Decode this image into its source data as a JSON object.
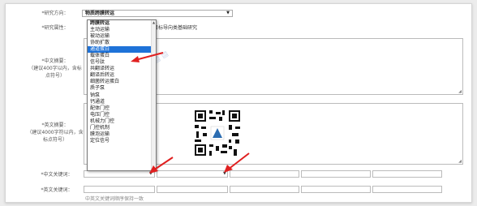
{
  "form": {
    "research_direction": {
      "label": "*研究方向：",
      "value": "物质跨膜转运"
    },
    "research_attribute": {
      "label": "*研究属性：",
      "text": "目标导向类基础研究"
    },
    "cn_abstract": {
      "label": "*中文摘要：",
      "hint": "（建议400字以内，含标点符号）"
    },
    "en_abstract": {
      "label": "*英文摘要：",
      "hint": "（建议4000字符以内，含标点符号）"
    },
    "cn_keywords": {
      "label": "*中文关键词："
    },
    "en_keywords": {
      "label": "*英文关键词：",
      "hint": "中英文关键词顺序保持一致"
    }
  },
  "dropdown": {
    "options": [
      {
        "label": "跨膜转运",
        "selected": false,
        "header": true
      },
      {
        "label": "主动运输",
        "selected": false,
        "header": false
      },
      {
        "label": "被动运输",
        "selected": false,
        "header": false
      },
      {
        "label": "协助扩散",
        "selected": false,
        "header": false
      },
      {
        "label": "通道蛋白",
        "selected": true,
        "header": false
      },
      {
        "label": "载体蛋白",
        "selected": false,
        "header": false
      },
      {
        "label": "信号肽",
        "selected": false,
        "header": false
      },
      {
        "label": "共翻译转运",
        "selected": false,
        "header": false
      },
      {
        "label": "翻译后转运",
        "selected": false,
        "header": false
      },
      {
        "label": "细菌转运蛋白",
        "selected": false,
        "header": false
      },
      {
        "label": "质子泵",
        "selected": false,
        "header": false
      },
      {
        "label": "钠泵",
        "selected": false,
        "header": false
      },
      {
        "label": "钙通道",
        "selected": false,
        "header": false
      },
      {
        "label": "配体门控",
        "selected": false,
        "header": false
      },
      {
        "label": "电压门控",
        "selected": false,
        "header": false
      },
      {
        "label": "机械力门控",
        "selected": false,
        "header": false
      },
      {
        "label": "门控机制",
        "selected": false,
        "header": false
      },
      {
        "label": "膜泡运输",
        "selected": false,
        "header": false
      },
      {
        "label": "定位信号",
        "selected": false,
        "header": false
      }
    ]
  },
  "colors": {
    "selected": "#1e72d8",
    "arrow": "#e02020"
  },
  "icons": {
    "caret": "chevron-down-icon",
    "resize": "resize-grip-icon"
  }
}
